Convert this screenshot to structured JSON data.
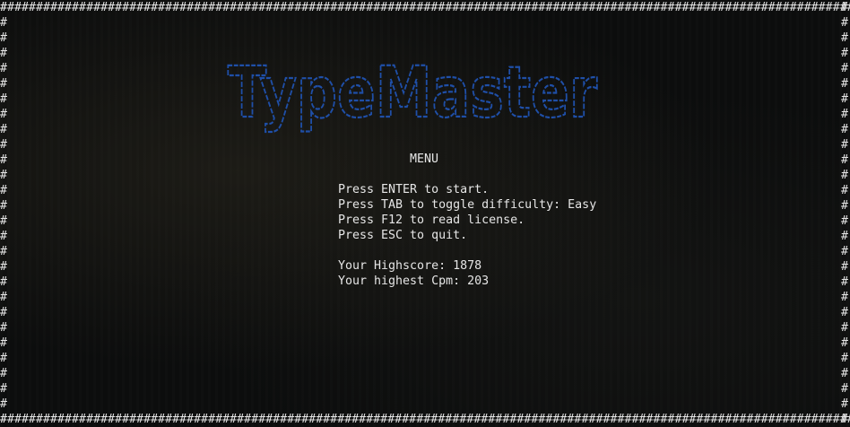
{
  "app": {
    "logo_text": "TypeMaster",
    "border_char": "#"
  },
  "menu": {
    "title": "MENU",
    "lines": [
      "Press ENTER to start.",
      "Press TAB to toggle difficulty: Easy",
      "Press F12 to read license.",
      "Press ESC to quit."
    ],
    "stats": [
      "Your Highscore: 1878",
      "Your highest Cpm: 203"
    ]
  },
  "colors": {
    "logo": "#1f4fa8",
    "text": "#e6e6e6",
    "background": "#0d0e0e"
  }
}
